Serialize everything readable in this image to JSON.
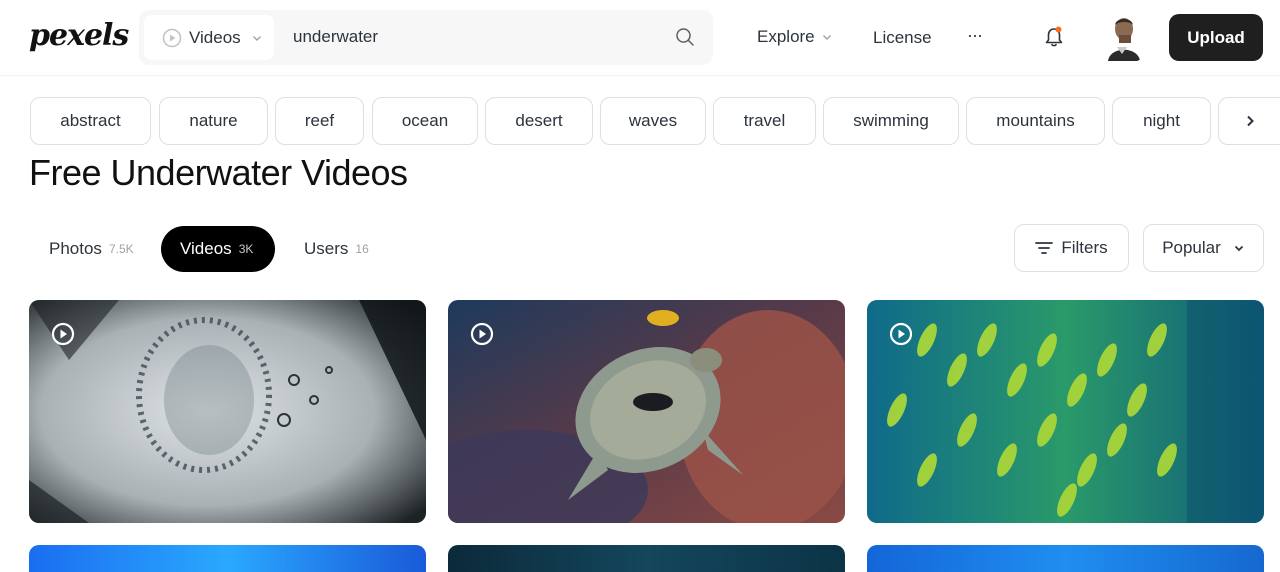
{
  "header": {
    "logo": "pexels",
    "search": {
      "type_label": "Videos",
      "query": "underwater"
    },
    "nav": {
      "explore": "Explore",
      "license": "License",
      "more": "···"
    },
    "upload_label": "Upload"
  },
  "tags": [
    "abstract",
    "nature",
    "reef",
    "ocean",
    "desert",
    "waves",
    "travel",
    "swimming",
    "mountains",
    "night"
  ],
  "page_title": "Free Underwater Videos",
  "tabs": [
    {
      "label": "Photos",
      "count": "7.5K"
    },
    {
      "label": "Videos",
      "count": "3K"
    },
    {
      "label": "Users",
      "count": "16"
    }
  ],
  "filters_label": "Filters",
  "sort_label": "Popular",
  "icons": {
    "type_select": "play-circle-icon",
    "search": "search-icon",
    "bell": "bell-icon",
    "next": "chevron-right-icon",
    "filters": "filter-lines-icon",
    "card": "play-circle-icon"
  },
  "colors": {
    "brand_dark": "#1f1f1f",
    "active_tab": "#000000",
    "notification_dot": "#f36f21"
  }
}
